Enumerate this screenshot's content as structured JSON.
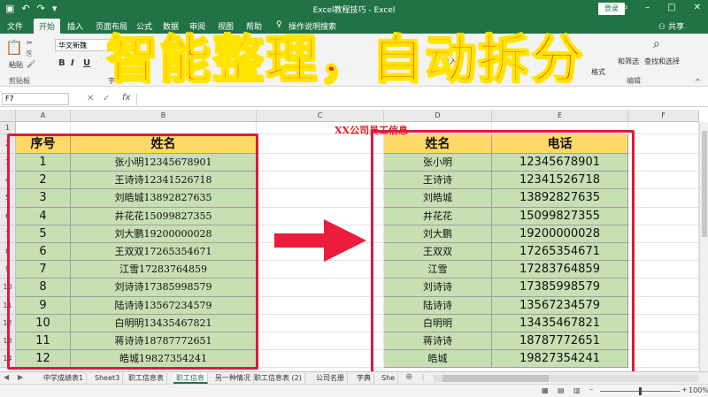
{
  "window": {
    "title": "Excel教程技巧 - Excel",
    "login_label": "登录"
  },
  "tabs": [
    "文件",
    "开始",
    "插入",
    "页面布局",
    "公式",
    "数据",
    "审阅",
    "视图",
    "帮助"
  ],
  "tell_me": "操作说明搜索",
  "share": "共享",
  "ribbon": {
    "paste": "粘贴",
    "clipboard": "剪贴板",
    "font_name": "华文新魏",
    "font_group": "字",
    "insert": "插入",
    "find_select": "查找和选择",
    "sort_filter": "和筛选",
    "editing": "编辑",
    "format": "格式"
  },
  "overlay_text": "智能整理，自动拆分",
  "formula_bar": {
    "name_box": "F7",
    "fx": "fx"
  },
  "columns": [
    "A",
    "B",
    "C",
    "D",
    "E",
    "F"
  ],
  "rows": [
    "1",
    "2",
    "3",
    "4",
    "5",
    "6",
    "7",
    "8",
    "9",
    "10",
    "11",
    "12",
    "13",
    "14"
  ],
  "company_title": "XX公司员工信息",
  "left_table": {
    "headers": [
      "序号",
      "姓名"
    ],
    "rows": [
      [
        "1",
        "张小明12345678901"
      ],
      [
        "2",
        "王诗诗12341526718"
      ],
      [
        "3",
        "刘皓城13892827635"
      ],
      [
        "4",
        "井花花15099827355"
      ],
      [
        "5",
        "刘大鹏19200000028"
      ],
      [
        "6",
        "王双双17265354671"
      ],
      [
        "7",
        "江雪17283764859"
      ],
      [
        "8",
        "刘诗诗17385998579"
      ],
      [
        "9",
        "陆诗诗13567234579"
      ],
      [
        "10",
        "白明明13435467821"
      ],
      [
        "11",
        "蒋诗诗18787772651"
      ],
      [
        "12",
        "皓城19827354241"
      ]
    ]
  },
  "right_table": {
    "headers": [
      "姓名",
      "电话"
    ],
    "rows": [
      [
        "张小明",
        "12345678901"
      ],
      [
        "王诗诗",
        "12341526718"
      ],
      [
        "刘皓城",
        "13892827635"
      ],
      [
        "井花花",
        "15099827355"
      ],
      [
        "刘大鹏",
        "19200000028"
      ],
      [
        "王双双",
        "17265354671"
      ],
      [
        "江雪",
        "17283764859"
      ],
      [
        "刘诗诗",
        "17385998579"
      ],
      [
        "陆诗诗",
        "13567234579"
      ],
      [
        "白明明",
        "13435467821"
      ],
      [
        "蒋诗诗",
        "18787772651"
      ],
      [
        "皓城",
        "19827354241"
      ]
    ]
  },
  "sheet_tabs": [
    "中学成绩表1",
    "Sheet3",
    "职工信息表",
    "职工信息",
    "另一种情况",
    "职工信息表 (2)",
    "公司名册",
    "字典",
    "She"
  ],
  "active_sheet": "职工信息",
  "zoom": "100%",
  "colors": {
    "excel_green": "#217346",
    "header_yellow": "#ffd966",
    "body_green": "#c6e0b4",
    "highlight_red": "#e3173c"
  }
}
